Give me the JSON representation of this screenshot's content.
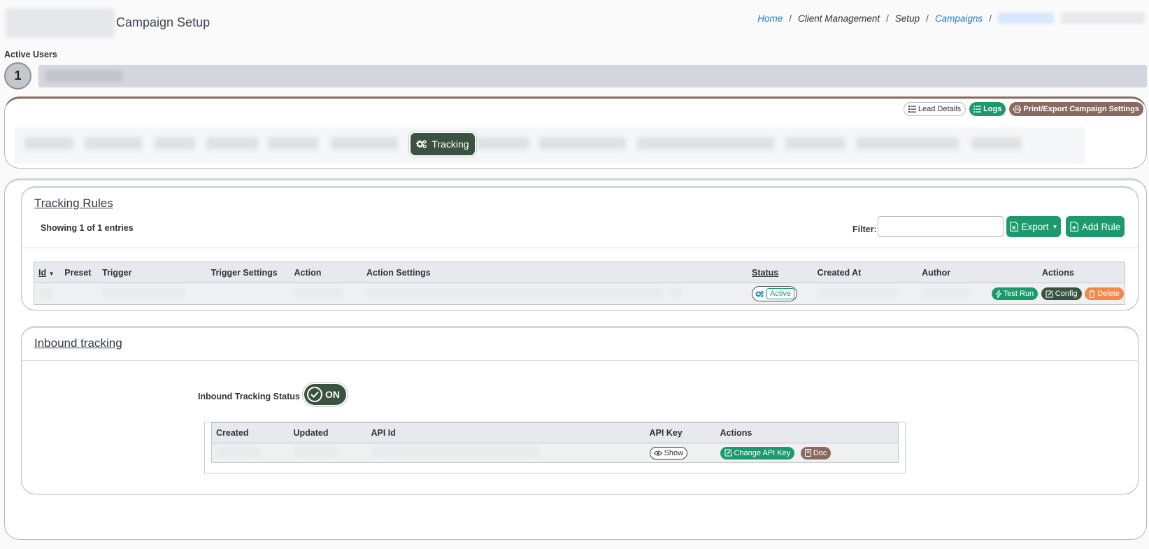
{
  "header": {
    "title": "Campaign Setup",
    "breadcrumb": [
      {
        "label": "Home",
        "link": true
      },
      {
        "label": "Client Management",
        "link": false
      },
      {
        "label": "Setup",
        "link": false
      },
      {
        "label": "Campaigns",
        "link": true
      }
    ]
  },
  "active_users": {
    "label": "Active Users",
    "count": "1"
  },
  "nav": {
    "actions": {
      "lead_details": "Lead Details",
      "logs": "Logs",
      "print_export": "Print/Export Campaign Settings"
    },
    "active_tab": "Tracking"
  },
  "tracking_rules": {
    "title": "Tracking Rules",
    "entries": "Showing 1 of 1 entries",
    "filter_label": "Filter:",
    "filter_value": "",
    "export_label": "Export",
    "add_rule_label": "Add Rule",
    "columns": {
      "id": "Id",
      "preset": "Preset",
      "trigger": "Trigger",
      "trigger_settings": "Trigger Settings",
      "action": "Action",
      "action_settings": "Action Settings",
      "status": "Status",
      "created_at": "Created At",
      "author": "Author",
      "actions": "Actions"
    },
    "row": {
      "status": "Active",
      "test_run": "Test Run",
      "config": "Config",
      "delete": "Delete"
    }
  },
  "inbound": {
    "title": "Inbound tracking",
    "status_label": "Inbound Tracking Status",
    "toggle_state": "ON",
    "columns": {
      "created": "Created",
      "updated": "Updated",
      "api_id": "API Id",
      "api_key": "API Key",
      "actions": "Actions"
    },
    "row": {
      "show": "Show",
      "change_key": "Change API Key",
      "doc": "Doc"
    }
  },
  "colors": {
    "green": "#1d9a6c",
    "dark_green": "#3a5240",
    "brown": "#8a6a5f",
    "orange": "#f08a4b",
    "link_blue": "#1a7fd1"
  }
}
